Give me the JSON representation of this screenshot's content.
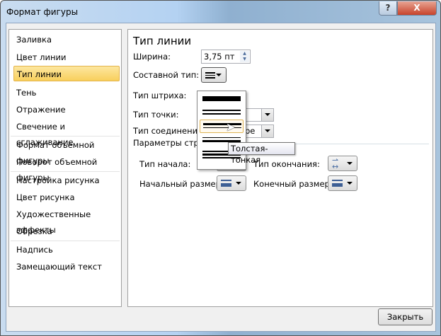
{
  "window": {
    "title": "Формат фигуры",
    "help": "?",
    "close": "X"
  },
  "sidebar": {
    "items": [
      {
        "label": "Заливка"
      },
      {
        "label": "Цвет линии"
      },
      {
        "label": "Тип линии"
      },
      {
        "label": "Тень"
      },
      {
        "label": "Отражение"
      },
      {
        "label": "Свечение и сглаживание"
      },
      {
        "label": "Формат объемной фигуры"
      },
      {
        "label": "Поворот объемной фигуры"
      },
      {
        "label": "Настройка рисунка"
      },
      {
        "label": "Цвет рисунка"
      },
      {
        "label": "Художественные эффекты"
      },
      {
        "label": "Обрезка"
      },
      {
        "label": "Надпись"
      },
      {
        "label": "Замещающий текст"
      }
    ],
    "selected": "Тип линии"
  },
  "main": {
    "title": "Тип линии",
    "width_label": "Ширина:",
    "width_value": "3,75 пт",
    "compound_label": "Составной тип:",
    "dash_label": "Тип штриха:",
    "cap_label": "Тип точки:",
    "join_label": "Тип соединения:",
    "join_value_visible": "ре",
    "arrows_label": "Параметры стрел",
    "begin_type": "Тип начала:",
    "end_type": "Тип окончания:",
    "begin_size": "Начальный размер:",
    "end_size": "Конечный размер:"
  },
  "dropdown": {
    "options": [
      "Простая",
      "Двойная",
      "Толстая-тонкая",
      "Тонкая-толстая",
      "Тройная"
    ],
    "hovered": "Толстая-тонкая"
  },
  "tooltip": "Толстая-тонкая",
  "footer": {
    "close_label": "Закрыть"
  }
}
